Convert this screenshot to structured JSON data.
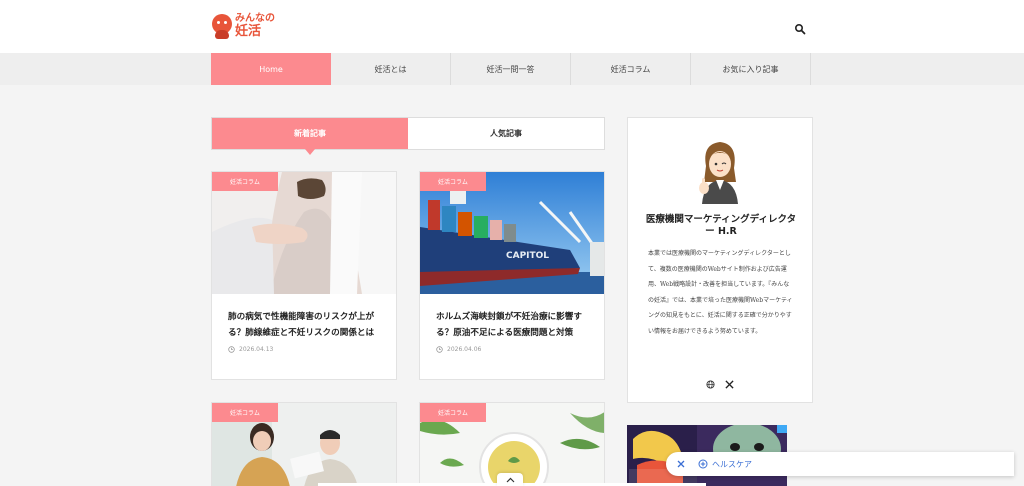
{
  "header": {
    "logo_line1": "みんなの",
    "logo_line2": "妊活"
  },
  "nav": {
    "items": [
      {
        "label": "Home"
      },
      {
        "label": "妊活とは"
      },
      {
        "label": "妊活一問一答"
      },
      {
        "label": "妊活コラム"
      },
      {
        "label": "お気に入り記事"
      }
    ]
  },
  "tabs": {
    "new_label": "新着記事",
    "popular_label": "人気記事"
  },
  "articles": [
    {
      "category": "妊活コラム",
      "title": "肺の病気で性機能障害のリスクが上がる？肺線維症と不妊リスクの関係とは",
      "date": "2026.04.13"
    },
    {
      "category": "妊活コラム",
      "title": "ホルムズ海峡封鎖が不妊治療に影響する？原油不足による医療問題と対策",
      "date": "2026.04.06"
    },
    {
      "category": "妊活コラム"
    },
    {
      "category": "妊活コラム"
    }
  ],
  "profile": {
    "name": "医療機関マーケティングディレクター H.R",
    "description": "本業では医療機関のマーケティングディレクターとして、複数の医療機関のWebサイト制作および広告運用、Web戦略設計・改善を担当しています。『みんなの妊活』では、本業で培った医療機関Webマーケティングの知見をもとに、妊活に関する正確で分かりやすい情報をお届けできるよう努めています。"
  },
  "float_bar": {
    "label": "ヘルスケア"
  },
  "colors": {
    "accent": "#fc8a8f",
    "logo": "#e8553a",
    "link": "#3b6fd4"
  }
}
